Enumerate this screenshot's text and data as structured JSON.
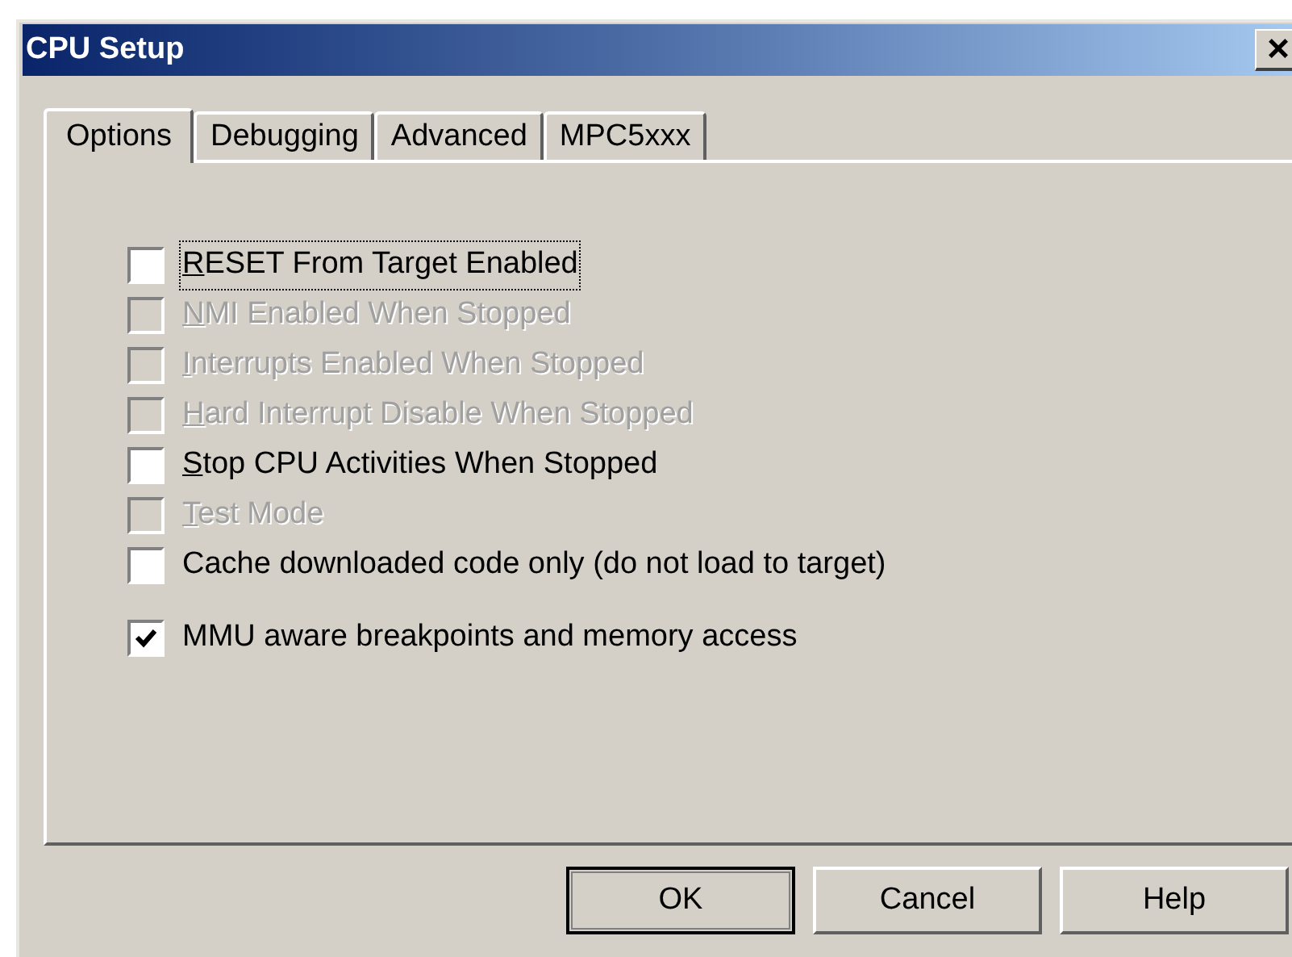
{
  "window": {
    "title": "CPU Setup",
    "close": "×"
  },
  "tabs": [
    {
      "label": "Options",
      "selected": true
    },
    {
      "label": "Debugging",
      "selected": false
    },
    {
      "label": "Advanced",
      "selected": false
    },
    {
      "label": "MPC5xxx",
      "selected": false
    }
  ],
  "options": [
    {
      "label": "RESET From Target Enabled",
      "checked": false,
      "disabled": false,
      "focused": true,
      "mnemonic": true
    },
    {
      "label": "NMI Enabled When Stopped",
      "checked": false,
      "disabled": true,
      "focused": false,
      "mnemonic": true
    },
    {
      "label": "Interrupts Enabled When Stopped",
      "checked": false,
      "disabled": true,
      "focused": false,
      "mnemonic": true
    },
    {
      "label": "Hard Interrupt Disable When Stopped",
      "checked": false,
      "disabled": true,
      "focused": false,
      "mnemonic": true
    },
    {
      "label": "Stop CPU Activities When Stopped",
      "checked": false,
      "disabled": false,
      "focused": false,
      "mnemonic": true
    },
    {
      "label": "Test Mode",
      "checked": false,
      "disabled": true,
      "focused": false,
      "mnemonic": true
    },
    {
      "label": "Cache downloaded code only (do not load to target)",
      "checked": false,
      "disabled": false,
      "focused": false,
      "mnemonic": false
    },
    {
      "label": "MMU aware breakpoints and memory access",
      "checked": true,
      "disabled": false,
      "focused": false,
      "mnemonic": false
    }
  ],
  "buttons": [
    {
      "label": "OK",
      "default": true
    },
    {
      "label": "Cancel",
      "default": false
    },
    {
      "label": "Help",
      "default": false
    }
  ]
}
